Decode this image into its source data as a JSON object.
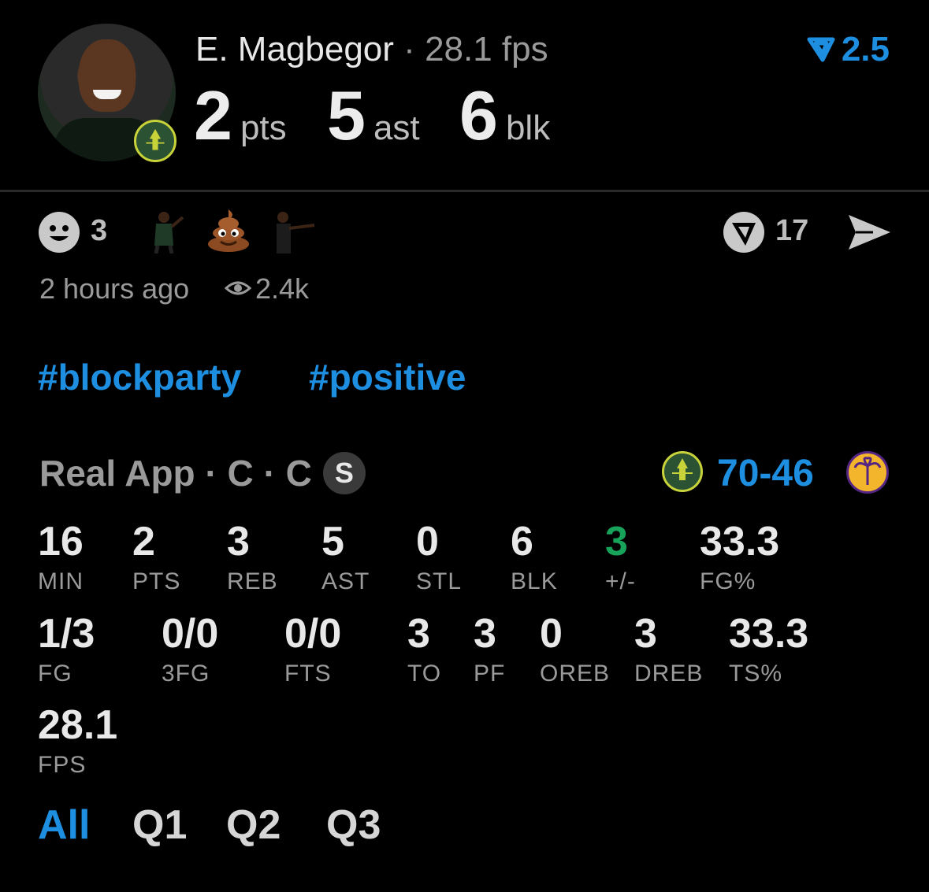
{
  "header": {
    "player_name": "E. Magbegor",
    "separator": "·",
    "fps_text": "28.1 fps",
    "rating": "2.5",
    "stats": [
      {
        "value": "2",
        "unit": "pts"
      },
      {
        "value": "5",
        "unit": "ast"
      },
      {
        "value": "6",
        "unit": "blk"
      }
    ]
  },
  "reactions": {
    "count": "3",
    "comment_count": "17",
    "timestamp": "2 hours ago",
    "views": "2.4k"
  },
  "hashtags": [
    "#blockparty",
    "#positive"
  ],
  "game": {
    "source": "Real App · C · C",
    "season_badge": "S",
    "score": "70-46"
  },
  "stats_row1": [
    {
      "value": "16",
      "label": "MIN"
    },
    {
      "value": "2",
      "label": "PTS"
    },
    {
      "value": "3",
      "label": "REB"
    },
    {
      "value": "5",
      "label": "AST"
    },
    {
      "value": "0",
      "label": "STL"
    },
    {
      "value": "6",
      "label": "BLK"
    },
    {
      "value": "3",
      "label": "+/-"
    },
    {
      "value": "33.3",
      "label": "FG%"
    }
  ],
  "stats_row2": [
    {
      "value": "1/3",
      "label": "FG"
    },
    {
      "value": "0/0",
      "label": "3FG"
    },
    {
      "value": "0/0",
      "label": "FTS"
    },
    {
      "value": "3",
      "label": "TO"
    },
    {
      "value": "3",
      "label": "PF"
    },
    {
      "value": "0",
      "label": "OREB"
    },
    {
      "value": "3",
      "label": "DREB"
    },
    {
      "value": "33.3",
      "label": "TS%"
    }
  ],
  "stats_row3": [
    {
      "value": "28.1",
      "label": "FPS"
    }
  ],
  "quarter_tabs": [
    "All",
    "Q1",
    "Q2",
    "Q3"
  ],
  "colors": {
    "accent": "#1e8fe0",
    "positive": "#17a35a",
    "background": "#000000"
  }
}
